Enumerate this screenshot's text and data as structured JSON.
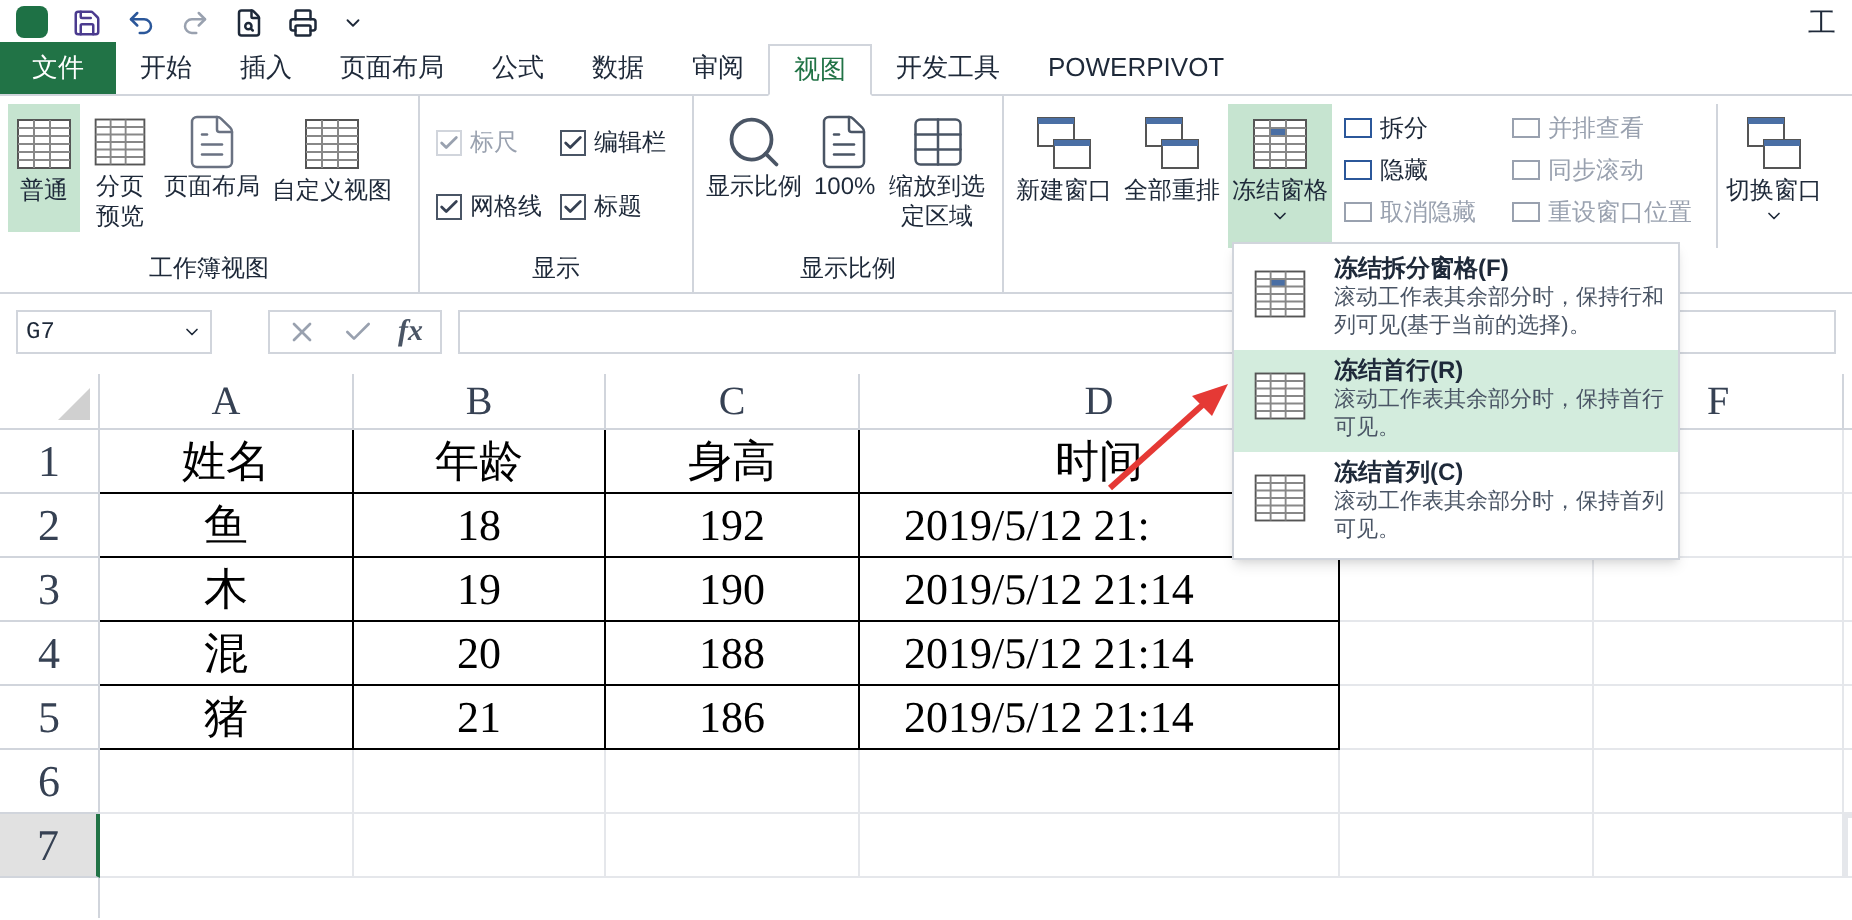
{
  "window": {
    "title": "工"
  },
  "tabs": [
    {
      "label": "文件",
      "kind": "file",
      "selected": false
    },
    {
      "label": "开始",
      "kind": "tab",
      "selected": false
    },
    {
      "label": "插入",
      "kind": "tab",
      "selected": false
    },
    {
      "label": "页面布局",
      "kind": "tab",
      "selected": false
    },
    {
      "label": "公式",
      "kind": "tab",
      "selected": false
    },
    {
      "label": "数据",
      "kind": "tab",
      "selected": false
    },
    {
      "label": "审阅",
      "kind": "tab",
      "selected": false
    },
    {
      "label": "视图",
      "kind": "tab",
      "selected": true
    },
    {
      "label": "开发工具",
      "kind": "tab",
      "selected": false
    },
    {
      "label": "POWERPIVOT",
      "kind": "tab",
      "selected": false
    }
  ],
  "ribbon": {
    "workbook_views": {
      "label": "工作簿视图",
      "buttons": [
        {
          "label": "普通",
          "selected": true
        },
        {
          "label": "分页预览",
          "selected": false
        },
        {
          "label": "页面布局",
          "selected": false
        },
        {
          "label": "自定义视图",
          "selected": false
        }
      ]
    },
    "show": {
      "label": "显示",
      "checkboxes": [
        {
          "label": "标尺",
          "checked": true,
          "disabled": true
        },
        {
          "label": "编辑栏",
          "checked": true,
          "disabled": false
        },
        {
          "label": "网格线",
          "checked": true,
          "disabled": false
        },
        {
          "label": "标题",
          "checked": true,
          "disabled": false
        }
      ]
    },
    "zoom": {
      "label": "显示比例",
      "buttons": [
        "显示比例",
        "100%",
        "缩放到选定区域"
      ]
    },
    "window": {
      "large_buttons": [
        {
          "label": "新建窗口",
          "open": false
        },
        {
          "label": "全部重排",
          "open": false
        },
        {
          "label": "冻结窗格",
          "open": true
        }
      ],
      "small_buttons": [
        {
          "label": "拆分",
          "disabled": false
        },
        {
          "label": "隐藏",
          "disabled": false
        },
        {
          "label": "取消隐藏",
          "disabled": true
        },
        {
          "label": "并排查看",
          "disabled": true
        },
        {
          "label": "同步滚动",
          "disabled": true
        },
        {
          "label": "重设窗口位置",
          "disabled": true
        }
      ],
      "switch_button": "切换窗口"
    }
  },
  "freeze_menu": [
    {
      "title": "冻结拆分窗格(F)",
      "description": "滚动工作表其余部分时，保持行和列可见(基于当前的选择)。",
      "selected": false
    },
    {
      "title": "冻结首行(R)",
      "description": "滚动工作表其余部分时，保持首行可见。",
      "selected": true
    },
    {
      "title": "冻结首列(C)",
      "description": "滚动工作表其余部分时，保持首列可见。",
      "selected": false
    }
  ],
  "formula_bar": {
    "name_box": "G7",
    "function_label": "fx"
  },
  "sheet": {
    "columns": [
      {
        "kind": "labeled",
        "label": "A"
      },
      {
        "kind": "labeled",
        "label": "B"
      },
      {
        "kind": "labeled",
        "label": "C"
      },
      {
        "kind": "labeled",
        "label": "D"
      },
      {
        "kind": "blank"
      },
      {
        "kind": "labeled",
        "label": "F"
      },
      {
        "kind": "blank"
      }
    ],
    "rows": [
      {
        "header": "1",
        "kind": "title",
        "selected": false,
        "cells": [
          "姓名",
          "年龄",
          "身高",
          "时间"
        ]
      },
      {
        "header": "2",
        "kind": "data",
        "selected": false,
        "cells": [
          "鱼",
          "18",
          "192",
          "2019/5/12 21:"
        ]
      },
      {
        "header": "3",
        "kind": "data",
        "selected": false,
        "cells": [
          "木",
          "19",
          "190",
          "2019/5/12 21:14"
        ]
      },
      {
        "header": "4",
        "kind": "data",
        "selected": false,
        "cells": [
          "混",
          "20",
          "188",
          "2019/5/12 21:14"
        ]
      },
      {
        "header": "5",
        "kind": "data",
        "selected": false,
        "cells": [
          "猪",
          "21",
          "186",
          "2019/5/12 21:14"
        ]
      },
      {
        "header": "6",
        "kind": "empty",
        "selected": false,
        "cells": []
      },
      {
        "header": "7",
        "kind": "empty",
        "selected": true,
        "cells": []
      }
    ]
  }
}
